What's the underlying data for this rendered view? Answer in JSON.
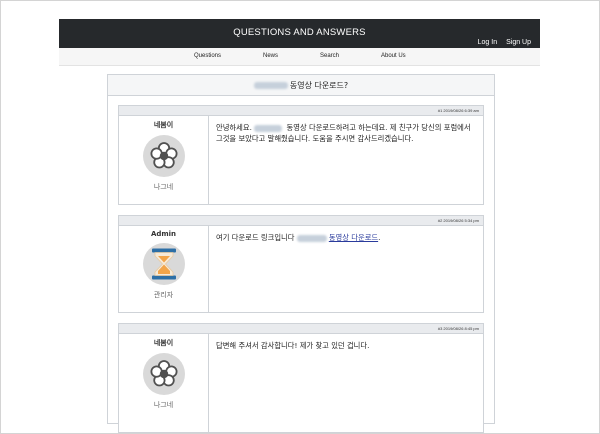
{
  "site": {
    "title": "QUESTIONS AND ANSWERS",
    "login": "Log In",
    "signup": "Sign Up"
  },
  "nav": [
    "Questions",
    "News",
    "Search",
    "About Us"
  ],
  "thread": {
    "title": "동영상 다운로드?"
  },
  "posts": [
    {
      "meta": "#1 2019/08/26 6:39 am",
      "author": "네봄이",
      "role": "나그네",
      "avatar_icon": "flower-icon",
      "body_before": "안녕하세요. ",
      "body_after": " 동영상 다운로드하려고 하는데요. 제 친구가 당신의 포럼에서 그것을 보았다고 말해줬습니다. 도움을 주시면 감사드리겠습니다."
    },
    {
      "meta": "#2 2019/08/26 5:34 pm",
      "author": "Admin",
      "role": "관리자",
      "avatar_icon": "hourglass-icon",
      "body_before": "여기 다운로드 링크입니다 ",
      "link_text": "동영상 다운로드",
      "body_after": "."
    },
    {
      "meta": "#3 2019/08/26 8:45 pm",
      "author": "네봄이",
      "role": "나그네",
      "avatar_icon": "flower-icon",
      "body": "답변해 주셔서 감사합니다! 제가 찾고 있던 겁니다."
    }
  ],
  "colors": {
    "header_bg": "#26292c",
    "link": "#2a3b9c",
    "hourglass_sand": "#f2a54a",
    "hourglass_frame": "#2d6fa6"
  }
}
